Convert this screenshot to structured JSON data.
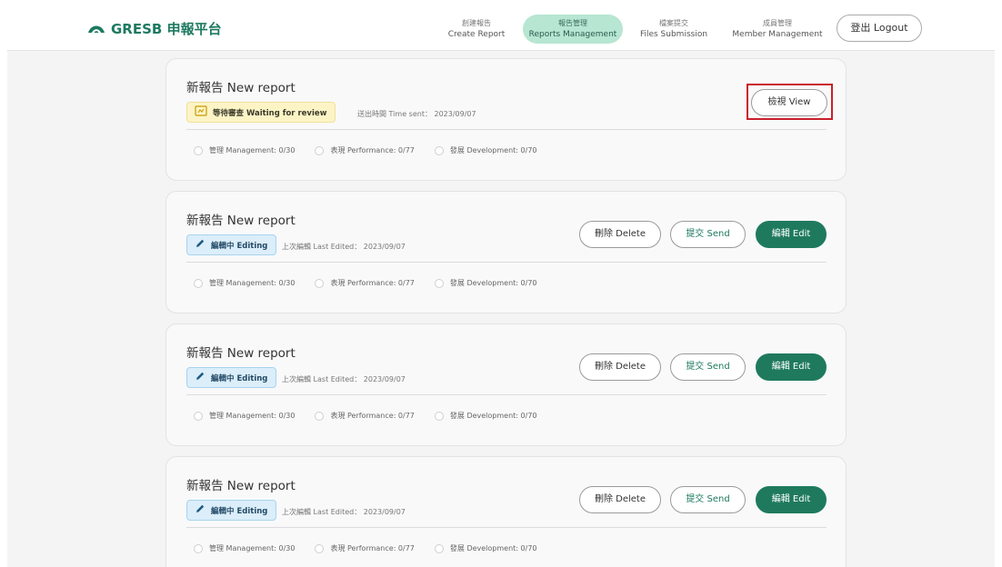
{
  "brand": {
    "logo_icon": "mountain-icon",
    "name": "GRESB 申報平台"
  },
  "nav": [
    {
      "zh": "創建報告",
      "en": "Create Report",
      "active": false
    },
    {
      "zh": "報告管理",
      "en": "Reports Management",
      "active": true
    },
    {
      "zh": "檔案提交",
      "en": "Files Submission",
      "active": false
    },
    {
      "zh": "成員管理",
      "en": "Member Management",
      "active": false
    }
  ],
  "logout_label": "登出 Logout",
  "colors": {
    "accent": "#1f7a5d",
    "nav_active_bg": "#b7e6d2",
    "highlight": "#c8202a"
  },
  "reports": [
    {
      "title": "新報告 New report",
      "status": "等待審查 Waiting for review",
      "status_icon": "pending-review-icon",
      "meta": "送出時間 Time sent： 2023/09/07",
      "view_label": "檢視 View",
      "stats": [
        "管理 Management: 0/30",
        "表現 Performance: 0/77",
        "發展 Development: 0/70"
      ]
    },
    {
      "title": "新報告 New report",
      "status": "編輯中 Editing",
      "status_icon": "pencil-icon",
      "meta": "上次編輯 Last Edited： 2023/09/07",
      "delete_label": "刪除 Delete",
      "send_label": "提交 Send",
      "edit_label": "編輯 Edit",
      "stats": [
        "管理 Management: 0/30",
        "表現 Performance: 0/77",
        "發展 Development: 0/70"
      ]
    },
    {
      "title": "新報告 New report",
      "status": "編輯中 Editing",
      "status_icon": "pencil-icon",
      "meta": "上次編輯 Last Edited： 2023/09/07",
      "delete_label": "刪除 Delete",
      "send_label": "提交 Send",
      "edit_label": "編輯 Edit",
      "stats": [
        "管理 Management: 0/30",
        "表現 Performance: 0/77",
        "發展 Development: 0/70"
      ]
    },
    {
      "title": "新報告 New report",
      "status": "編輯中 Editing",
      "status_icon": "pencil-icon",
      "meta": "上次編輯 Last Edited： 2023/09/07",
      "delete_label": "刪除 Delete",
      "send_label": "提交 Send",
      "edit_label": "編輯 Edit",
      "stats": [
        "管理 Management: 0/30",
        "表現 Performance: 0/77",
        "發展 Development: 0/70"
      ]
    }
  ]
}
